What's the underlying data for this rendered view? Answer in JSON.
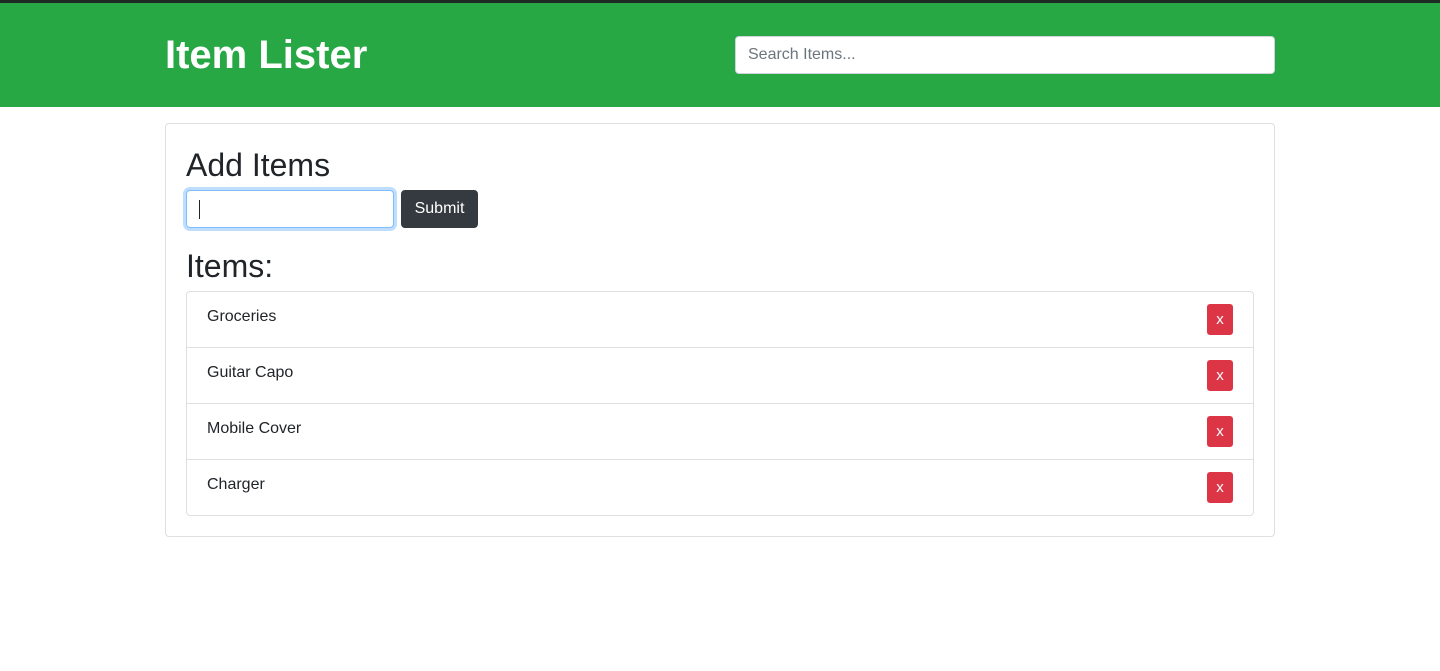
{
  "header": {
    "brand": "Item Lister",
    "search_placeholder": "Search Items..."
  },
  "form": {
    "title": "Add Items",
    "input_value": "",
    "submit_label": "Submit"
  },
  "list": {
    "title": "Items:",
    "items": [
      {
        "label": "Groceries",
        "delete_label": "x"
      },
      {
        "label": "Guitar Capo",
        "delete_label": "x"
      },
      {
        "label": "Mobile Cover",
        "delete_label": "x"
      },
      {
        "label": "Charger",
        "delete_label": "x"
      }
    ]
  },
  "colors": {
    "header_bg": "#28a745",
    "submit_bg": "#343a40",
    "delete_bg": "#dc3545"
  }
}
